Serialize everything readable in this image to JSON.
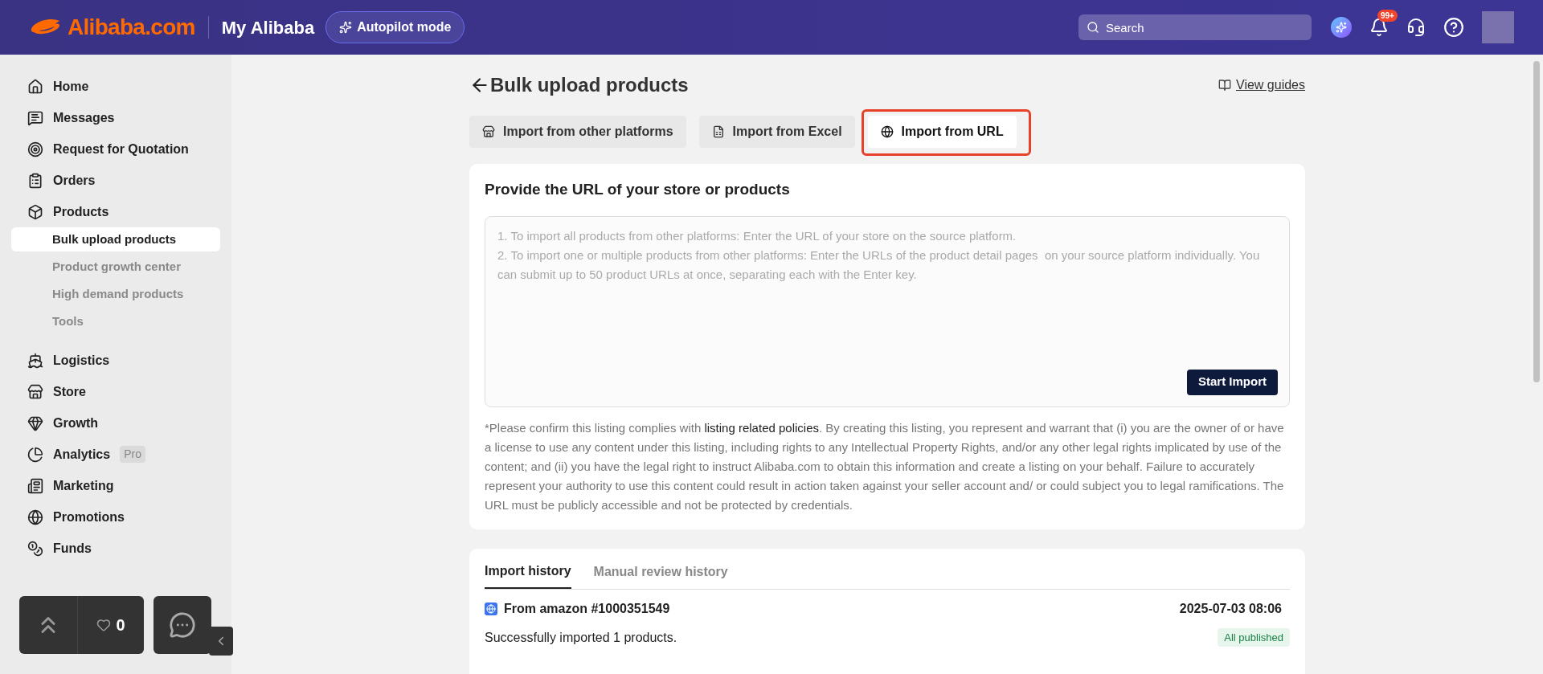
{
  "header": {
    "logo": "Alibaba.com",
    "title": "My Alibaba",
    "autopilot": "Autopilot mode",
    "search": {
      "placeholder": "Search"
    },
    "notification_badge": "99+"
  },
  "sidebar": {
    "items": [
      {
        "label": "Home",
        "selected": false
      },
      {
        "label": "Messages",
        "selected": false
      },
      {
        "label": "Request for Quotation",
        "selected": false
      },
      {
        "label": "Orders",
        "selected": false
      },
      {
        "label": "Products",
        "selected": false,
        "expanded": true,
        "children": [
          {
            "label": "Bulk upload products",
            "selected": true
          },
          {
            "label": "Product growth center",
            "selected": false
          },
          {
            "label": "High demand products",
            "selected": false
          },
          {
            "label": "Tools",
            "selected": false
          }
        ]
      },
      {
        "label": "Logistics",
        "selected": false
      },
      {
        "label": "Store",
        "selected": false
      },
      {
        "label": "Growth",
        "selected": false
      },
      {
        "label": "Analytics",
        "selected": false,
        "badge": "Pro"
      },
      {
        "label": "Marketing",
        "selected": false
      },
      {
        "label": "Promotions",
        "selected": false
      },
      {
        "label": "Funds",
        "selected": false
      }
    ]
  },
  "floating": {
    "favorites_count": "0"
  },
  "page": {
    "title": "Bulk upload products",
    "guides_link": "View guides",
    "tabs": [
      {
        "label": "Import from other platforms",
        "selected": false,
        "highlighted": false
      },
      {
        "label": "Import from Excel",
        "selected": false,
        "highlighted": false
      },
      {
        "label": "Import from URL",
        "selected": true,
        "highlighted": true
      }
    ],
    "url_card": {
      "heading": "Provide the URL of your store or products",
      "placeholder": "1. To import all products from other platforms: Enter the URL of your store on the source platform.\n2. To import one or multiple products from other platforms: Enter the URLs of the product detail pages  on your source platform individually. You can submit up to 50 product URLs at once, separating each with the Enter key.",
      "button": "Start Import",
      "disclaimer_before": "*Please confirm this listing complies with ",
      "disclaimer_link": "listing related policies",
      "disclaimer_after": ". By creating this listing, you represent and warrant that (i) you are the owner of or have a license to use any content under this listing, including rights to any Intellectual Property Rights, and/or any other legal rights implicated by use of the content; and (ii) you have the legal right to instruct Alibaba.com to obtain this information and create a listing on your behalf. Failure to accurately represent your authority to use this content could result in action taken against your seller account and/ or could subject you to legal ramifications. The URL must be publicly accessible and not be protected by credentials."
    },
    "history": {
      "tabs": [
        {
          "label": "Import history",
          "selected": true
        },
        {
          "label": "Manual review history",
          "selected": false
        }
      ],
      "records": [
        {
          "source": "From amazon #1000351549",
          "time": "2025-07-03 08:06",
          "message": "Successfully imported 1 products.",
          "status": "All published"
        }
      ]
    }
  }
}
